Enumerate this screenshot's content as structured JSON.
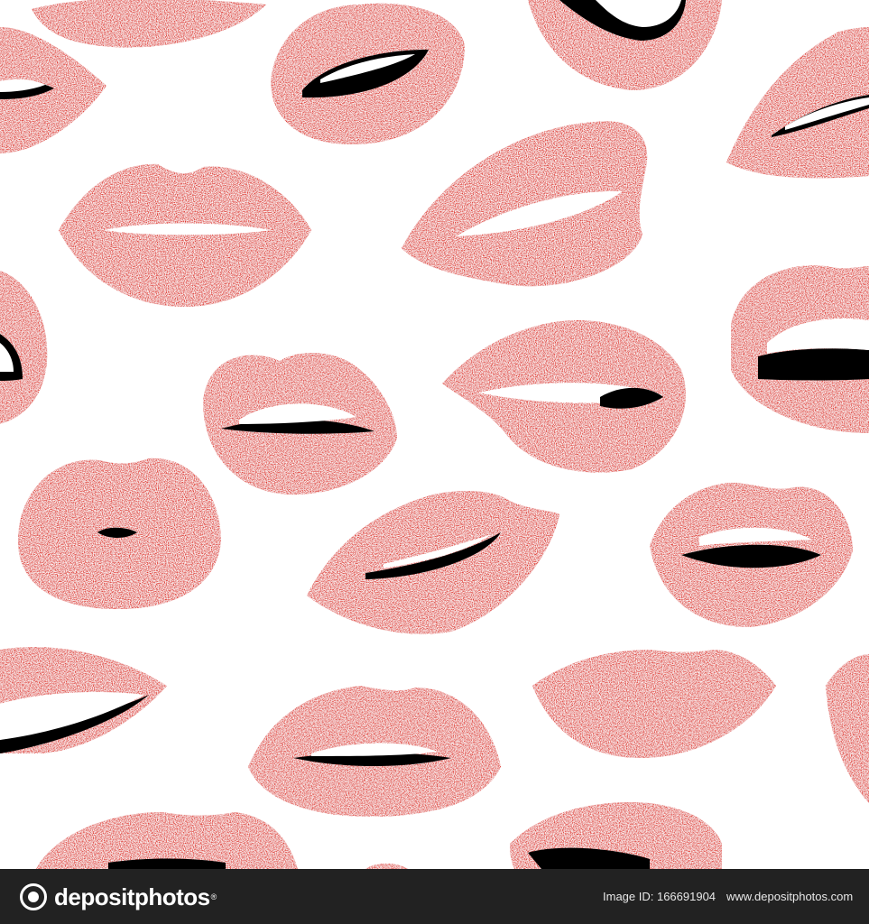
{
  "footer": {
    "brand": "depositphotos",
    "registered_mark": "®",
    "image_id": "Image ID: 166691904",
    "site_url": "www.depositphotos.com"
  },
  "colors": {
    "background": "#ffffff",
    "glitter_base": "#e0342c",
    "glitter_light": "#ff8a80",
    "glitter_dark": "#a8141a",
    "mouth": "#000000",
    "teeth": "#ffffff",
    "footer_bg": "#222222"
  },
  "icons": {
    "logo": "depositphotos-logo-icon"
  }
}
